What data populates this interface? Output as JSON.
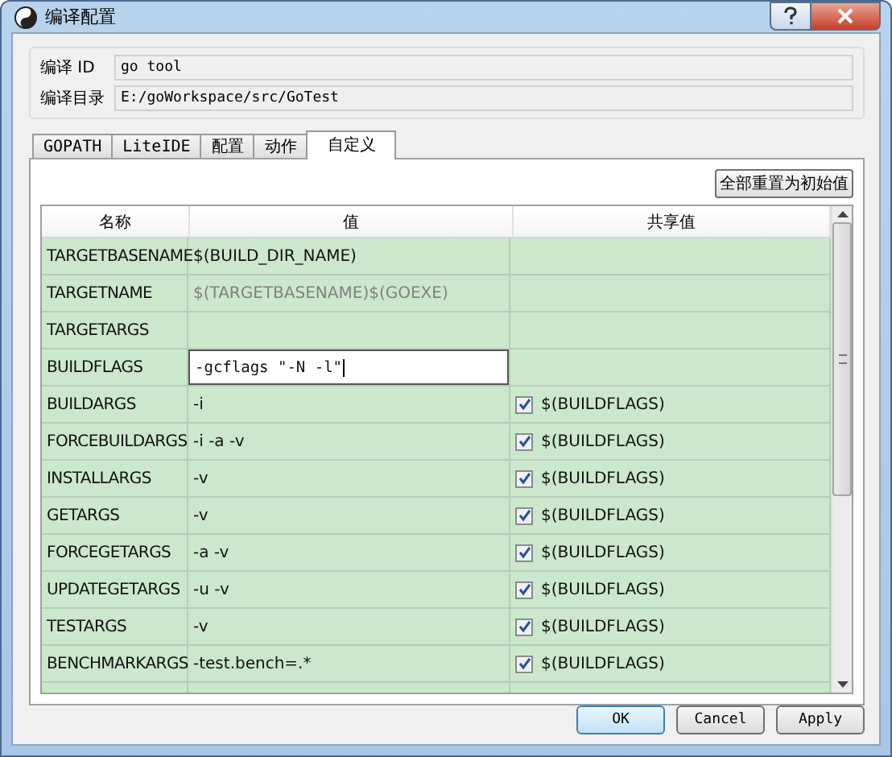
{
  "window": {
    "title": "编译配置"
  },
  "info": [
    {
      "label": "编译 ID",
      "value": "go tool"
    },
    {
      "label": "编译目录",
      "value": "E:/goWorkspace/src/GoTest"
    }
  ],
  "tabs": [
    {
      "label": "GOPATH",
      "selected": false
    },
    {
      "label": "LiteIDE",
      "selected": false
    },
    {
      "label": "配置",
      "selected": false
    },
    {
      "label": "动作",
      "selected": false
    },
    {
      "label": "自定义",
      "selected": true
    }
  ],
  "reset_button": "全部重置为初始值",
  "table": {
    "columns": [
      "名称",
      "值",
      "共享值"
    ],
    "rows": [
      {
        "name": "TARGETBASENAME",
        "value": "$(BUILD_DIR_NAME)",
        "kind": "plain"
      },
      {
        "name": "TARGETNAME",
        "value": "$(TARGETBASENAME)$(GOEXE)",
        "kind": "inherited"
      },
      {
        "name": "TARGETARGS",
        "kind": "plain"
      },
      {
        "name": "BUILDFLAGS",
        "value": "-gcflags \"-N -l\"",
        "kind": "editing"
      },
      {
        "name": "BUILDARGS",
        "value": "-i",
        "kind": "plain",
        "shared": {
          "checked": true,
          "text": "$(BUILDFLAGS)"
        }
      },
      {
        "name": "FORCEBUILDARGS",
        "value": "-i -a -v",
        "kind": "plain",
        "shared": {
          "checked": true,
          "text": "$(BUILDFLAGS)"
        }
      },
      {
        "name": "INSTALLARGS",
        "value": "-v",
        "kind": "plain",
        "shared": {
          "checked": true,
          "text": "$(BUILDFLAGS)"
        }
      },
      {
        "name": "GETARGS",
        "value": "-v",
        "kind": "plain",
        "shared": {
          "checked": true,
          "text": "$(BUILDFLAGS)"
        }
      },
      {
        "name": "FORCEGETARGS",
        "value": "-a -v",
        "kind": "plain",
        "shared": {
          "checked": true,
          "text": "$(BUILDFLAGS)"
        }
      },
      {
        "name": "UPDATEGETARGS",
        "value": "-u -v",
        "kind": "plain",
        "shared": {
          "checked": true,
          "text": "$(BUILDFLAGS)"
        }
      },
      {
        "name": "TESTARGS",
        "value": "-v",
        "kind": "plain",
        "shared": {
          "checked": true,
          "text": "$(BUILDFLAGS)"
        }
      },
      {
        "name": "BENCHMARKARGS",
        "value": "-test.bench=.*",
        "kind": "plain",
        "shared": {
          "checked": true,
          "text": "$(BUILDFLAGS)"
        }
      }
    ]
  },
  "buttons": [
    "OK",
    "Cancel",
    "Apply"
  ]
}
